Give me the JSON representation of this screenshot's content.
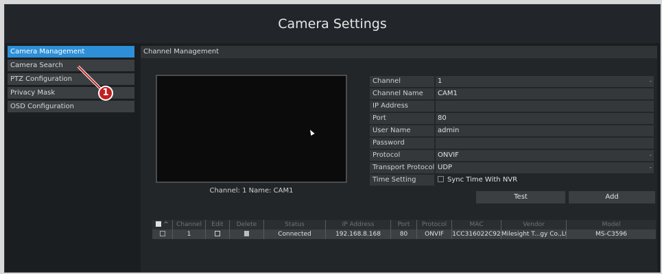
{
  "title": "Camera Settings",
  "sidebar": {
    "items": [
      {
        "label": "Camera Management",
        "active": true
      },
      {
        "label": "Camera Search",
        "active": false
      },
      {
        "label": "PTZ Configuration",
        "active": false
      },
      {
        "label": "Privacy Mask",
        "active": false
      },
      {
        "label": "OSD Configuration",
        "active": false
      }
    ]
  },
  "main": {
    "header": "Channel Management",
    "preview_caption": "Channel: 1 Name: CAM1",
    "form": {
      "channel_label": "Channel",
      "channel_value": "1",
      "channel_name_label": "Channel Name",
      "channel_name_value": "CAM1",
      "ip_label": "IP Address",
      "ip_value": "",
      "port_label": "Port",
      "port_value": "80",
      "user_label": "User Name",
      "user_value": "admin",
      "password_label": "Password",
      "password_value": "",
      "protocol_label": "Protocol",
      "protocol_value": "ONVIF",
      "transport_label": "Transport Protocol",
      "transport_value": "UDP",
      "time_label": "Time Setting",
      "time_value": "Sync Time With NVR",
      "dropdown_glyph": "-"
    },
    "buttons": {
      "test": "Test",
      "add": "Add"
    },
    "table": {
      "headers": [
        "Channel",
        "Edit",
        "Delete",
        "Status",
        "IP Address",
        "Port",
        "Protocol",
        "MAC",
        "Vendor",
        "Model"
      ],
      "sort_glyph": "^",
      "rows": [
        {
          "channel": "1",
          "status": "Connected",
          "ip": "192.168.8.168",
          "port": "80",
          "protocol": "ONVIF",
          "mac": "1CC316022C92",
          "vendor": "Milesight T...gy Co.,Ltd.",
          "model": "MS-C3596"
        }
      ]
    }
  },
  "annotation": {
    "badge": "1",
    "color": "#c51f1f"
  },
  "colors": {
    "accent": "#2e8fd8",
    "background": "#1b1e20"
  }
}
